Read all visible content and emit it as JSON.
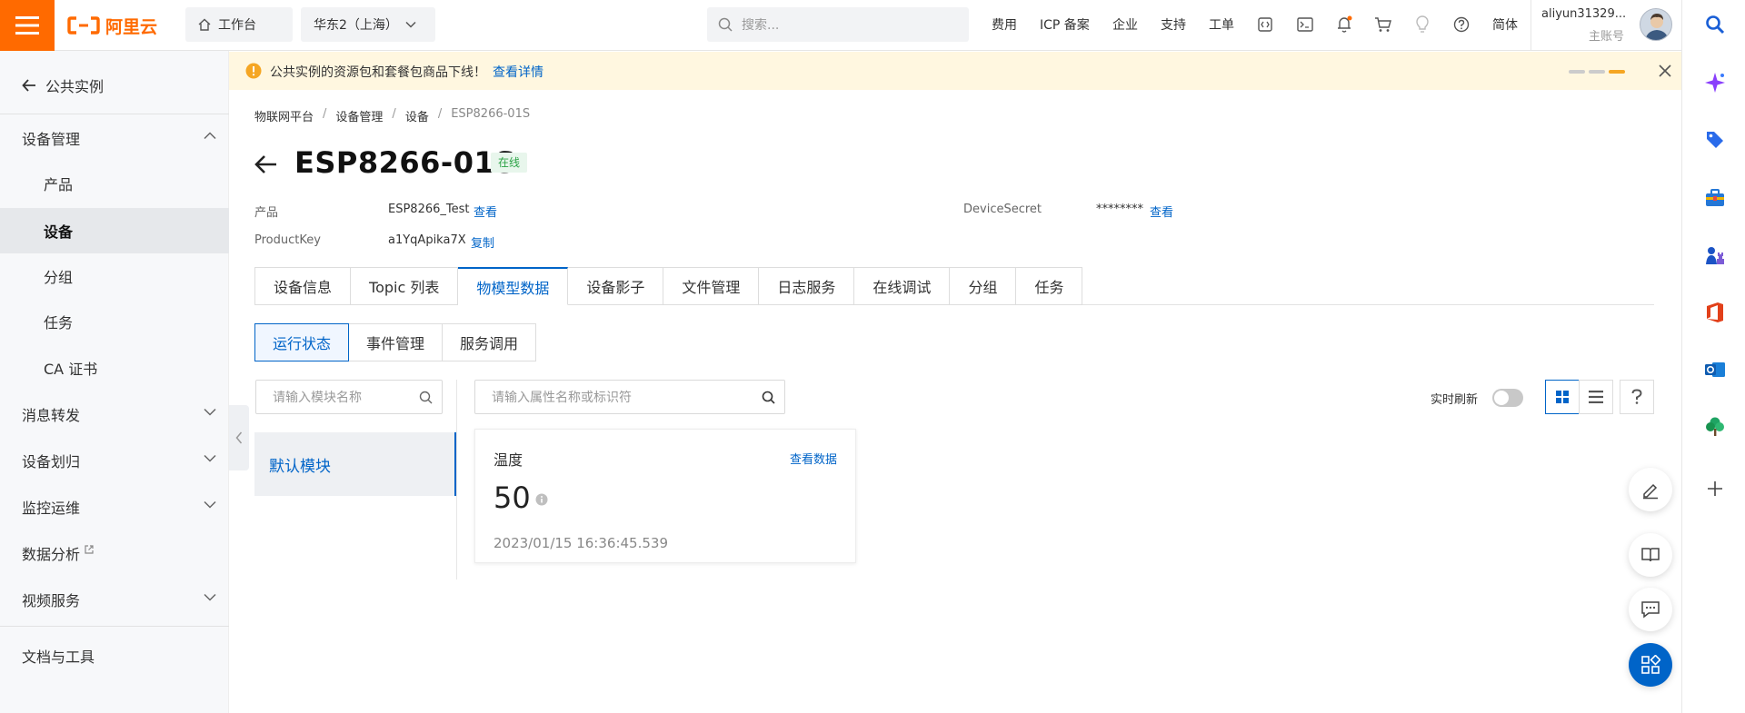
{
  "topbar": {
    "logo_text": "阿里云",
    "workbench": "工作台",
    "region": "华东2（上海）",
    "search_placeholder": "搜索...",
    "links": [
      "费用",
      "ICP 备案",
      "企业",
      "支持",
      "工单"
    ],
    "language": "简体",
    "account_name": "aliyun31329...",
    "account_role": "主账号"
  },
  "sidebar": {
    "back_label": "公共实例",
    "items": [
      {
        "label": "设备管理"
      },
      {
        "label": "产品"
      },
      {
        "label": "设备"
      },
      {
        "label": "分组"
      },
      {
        "label": "任务"
      },
      {
        "label": "CA 证书"
      },
      {
        "label": "消息转发"
      },
      {
        "label": "设备划归"
      },
      {
        "label": "监控运维"
      },
      {
        "label": "数据分析"
      },
      {
        "label": "视频服务"
      }
    ],
    "footer_label": "文档与工具"
  },
  "notice": {
    "text": "公共实例的资源包和套餐包商品下线！",
    "link": "查看详情"
  },
  "breadcrumb": [
    "物联网平台",
    "设备管理",
    "设备",
    "ESP8266-01S"
  ],
  "device": {
    "name": "ESP8266-01S",
    "status": "在线",
    "product_label": "产品",
    "product_value": "ESP8266_Test",
    "product_link": "查看",
    "productkey_label": "ProductKey",
    "productkey_value": "a1YqApika7X",
    "productkey_link": "复制",
    "secret_label": "DeviceSecret",
    "secret_value": "********",
    "secret_link": "查看"
  },
  "tabs": [
    "设备信息",
    "Topic 列表",
    "物模型数据",
    "设备影子",
    "文件管理",
    "日志服务",
    "在线调试",
    "分组",
    "任务"
  ],
  "subtabs": [
    "运行状态",
    "事件管理",
    "服务调用"
  ],
  "module_search_placeholder": "请输入模块名称",
  "property_search_placeholder": "请输入属性名称或标识符",
  "module_default": "默认模块",
  "realtime_refresh_label": "实时刷新",
  "property_card": {
    "name": "温度",
    "link": "查看数据",
    "value": "50",
    "timestamp": "2023/01/15 16:36:45.539"
  },
  "colors": {
    "brand": "#ff6a00",
    "primary": "#0064c8",
    "online": "#2ba245"
  }
}
